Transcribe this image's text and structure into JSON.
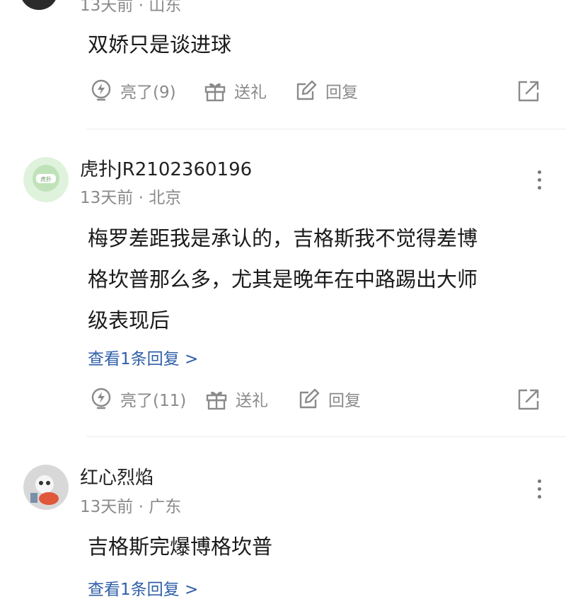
{
  "comments": [
    {
      "meta": "13天前 · 山东",
      "content_lines": [
        "双娇只是谈进球"
      ],
      "actions": {
        "like": "亮了(9)",
        "gift": "送礼",
        "reply": "回复"
      }
    },
    {
      "username": "虎扑JR2102360196",
      "meta": "13天前 · 北京",
      "content_lines": [
        "梅罗差距我是承认的，吉格斯我不觉得差博",
        "格坎普那么多，尤其是晚年在中路踢出大师",
        "级表现后"
      ],
      "reply_link": "查看1条回复 >",
      "actions": {
        "like": "亮了(11)",
        "gift": "送礼",
        "reply": "回复"
      }
    },
    {
      "username": "红心烈焰",
      "meta": "13天前 · 广东",
      "content_lines": [
        "吉格斯完爆博格坎普"
      ],
      "reply_link": "查看1条回复 >"
    }
  ],
  "icons": {
    "like": "lightning-bulb-icon",
    "gift": "gift-icon",
    "reply": "edit-reply-icon",
    "share": "share-icon",
    "more": "more-vertical-icon"
  },
  "colors": {
    "link": "#2f5fa8",
    "meta": "#8a8a8a",
    "divider": "#ececec"
  }
}
